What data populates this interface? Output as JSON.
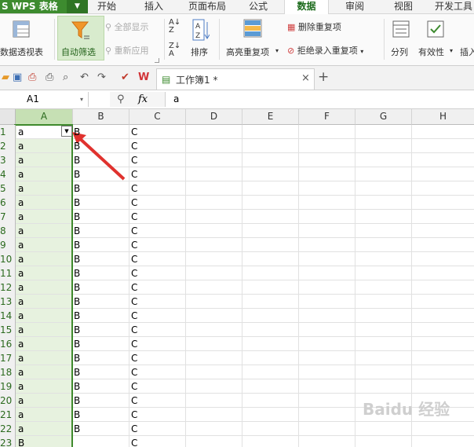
{
  "app": {
    "brand": "WPS 表格",
    "brand_prefix": "S",
    "dropdown": "▼"
  },
  "menu_tabs": [
    "开始",
    "插入",
    "页面布局",
    "公式",
    "数据",
    "审阅",
    "视图",
    "开发工具"
  ],
  "active_tab": "数据",
  "ribbon": {
    "pivot": "数据透视表",
    "autofilter": "自动筛选",
    "show_all": "全部显示",
    "reapply": "重新应用",
    "sort": "排序",
    "highlight_dup": "高亮重复项",
    "delete_dup": "删除重复项",
    "reject_dup": "拒绝录入重复项",
    "split": "分列",
    "validity": "有效性",
    "insert": "插入"
  },
  "document_tab": {
    "title": "工作簿1 *",
    "close": "×",
    "add": "+"
  },
  "formula_bar": {
    "name_box": "A1",
    "fx": "fx",
    "content": "a"
  },
  "columns": [
    "A",
    "B",
    "C",
    "D",
    "E",
    "F",
    "G",
    "H"
  ],
  "rows": [
    {
      "n": "1",
      "a": "a",
      "b": "B",
      "c": "C"
    },
    {
      "n": "2",
      "a": "a",
      "b": "B",
      "c": "C"
    },
    {
      "n": "3",
      "a": "a",
      "b": "B",
      "c": "C"
    },
    {
      "n": "4",
      "a": "a",
      "b": "B",
      "c": "C"
    },
    {
      "n": "5",
      "a": "a",
      "b": "B",
      "c": "C"
    },
    {
      "n": "6",
      "a": "a",
      "b": "B",
      "c": "C"
    },
    {
      "n": "7",
      "a": "a",
      "b": "B",
      "c": "C"
    },
    {
      "n": "8",
      "a": "a",
      "b": "B",
      "c": "C"
    },
    {
      "n": "9",
      "a": "a",
      "b": "B",
      "c": "C"
    },
    {
      "n": "10",
      "a": "a",
      "b": "B",
      "c": "C"
    },
    {
      "n": "11",
      "a": "a",
      "b": "B",
      "c": "C"
    },
    {
      "n": "12",
      "a": "a",
      "b": "B",
      "c": "C"
    },
    {
      "n": "13",
      "a": "a",
      "b": "B",
      "c": "C"
    },
    {
      "n": "14",
      "a": "a",
      "b": "B",
      "c": "C"
    },
    {
      "n": "15",
      "a": "a",
      "b": "B",
      "c": "C"
    },
    {
      "n": "16",
      "a": "a",
      "b": "B",
      "c": "C"
    },
    {
      "n": "17",
      "a": "a",
      "b": "B",
      "c": "C"
    },
    {
      "n": "18",
      "a": "a",
      "b": "B",
      "c": "C"
    },
    {
      "n": "19",
      "a": "a",
      "b": "B",
      "c": "C"
    },
    {
      "n": "20",
      "a": "a",
      "b": "B",
      "c": "C"
    },
    {
      "n": "21",
      "a": "a",
      "b": "B",
      "c": "C"
    },
    {
      "n": "22",
      "a": "a",
      "b": "B",
      "c": "C"
    },
    {
      "n": "23",
      "a": "B",
      "b": "",
      "c": "C"
    }
  ],
  "watermark": "Baidu 经验",
  "colors": {
    "brand_green": "#3d8b2f",
    "selection_fill": "#e7f2df",
    "arrow_red": "#e0322e"
  }
}
